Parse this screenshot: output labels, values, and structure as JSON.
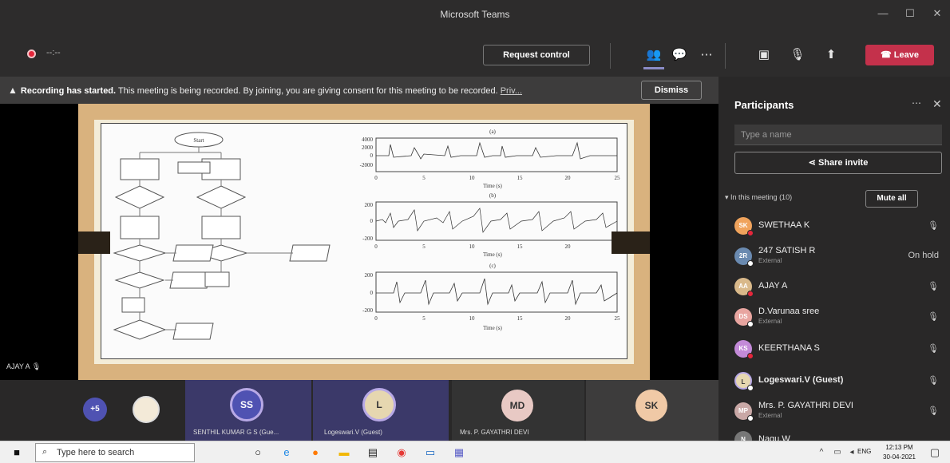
{
  "window": {
    "title": "Microsoft Teams"
  },
  "toolbar": {
    "timer": "--:--",
    "request_control": "Request control",
    "leave": "Leave",
    "leave_color": "#c4314b"
  },
  "banner": {
    "bold": "Recording has started.",
    "text": " This meeting is being recorded. By joining, you are giving consent for this meeting to be recorded. ",
    "link": "Priv...",
    "dismiss": "Dismiss"
  },
  "stage": {
    "speaker": "AJAY A",
    "figure": {
      "title_a": "(a)",
      "title_b": "(b)",
      "title_c": "(c)",
      "xlabel": "Time (s)",
      "xticks": [
        "0",
        "5",
        "10",
        "15",
        "20",
        "25"
      ],
      "yticks_a": [
        "4000",
        "2000",
        "0",
        "-2000"
      ],
      "yticks_b": [
        "200",
        "0",
        "-200"
      ],
      "yticks_c": [
        "200",
        "0",
        "-200"
      ],
      "flow_start": "Start"
    }
  },
  "strip": {
    "more": "+5",
    "tiles": [
      {
        "initials": "SS",
        "label": "SENTHIL KUMAR G S (Gue...",
        "color": "#4f52b2"
      },
      {
        "initials": "L",
        "label": "Logeswari.V (Guest)",
        "color": "#e6d7b0"
      },
      {
        "initials": "MD",
        "label": "Mrs. P. GAYATHRI DEVI",
        "color": "#e8c9c4"
      },
      {
        "initials": "SK",
        "label": "",
        "color": "#f0c9a6"
      }
    ]
  },
  "panel": {
    "title": "Participants",
    "search_placeholder": "Type a name",
    "share": "Share invite",
    "section": "In this meeting (10)",
    "mute_all": "Mute all",
    "participants": [
      {
        "initials": "SK",
        "name": "SWETHAA K",
        "sub": "",
        "right": "🎙",
        "color": "#f0a35c"
      },
      {
        "initials": "2R",
        "name": "247 SATISH R",
        "sub": "External",
        "right": "On hold",
        "color": "#6a8ab0"
      },
      {
        "initials": "AA",
        "name": "AJAY A",
        "sub": "",
        "right": "🎙",
        "color": "#d9b98a"
      },
      {
        "initials": "DS",
        "name": "D.Varunaa sree",
        "sub": "External",
        "right": "🎙",
        "color": "#e8a5a0"
      },
      {
        "initials": "KS",
        "name": "KEERTHANA S",
        "sub": "",
        "right": "🎙",
        "color": "#c38ad8"
      },
      {
        "initials": "L",
        "name": "Logeswari.V (Guest)",
        "sub": "",
        "right": "🎙",
        "color": "#e6d7b0"
      },
      {
        "initials": "MP",
        "name": "Mrs. P. GAYATHRI DEVI",
        "sub": "External",
        "right": "🎙",
        "color": "#c9a8a6"
      },
      {
        "initials": "N",
        "name": "Nagu.W",
        "sub": "",
        "right": "",
        "color": "#777777"
      }
    ]
  },
  "taskbar": {
    "search_placeholder": "Type here to search",
    "lang": "ENG",
    "time": "12:13 PM",
    "date": "30-04-2021"
  }
}
